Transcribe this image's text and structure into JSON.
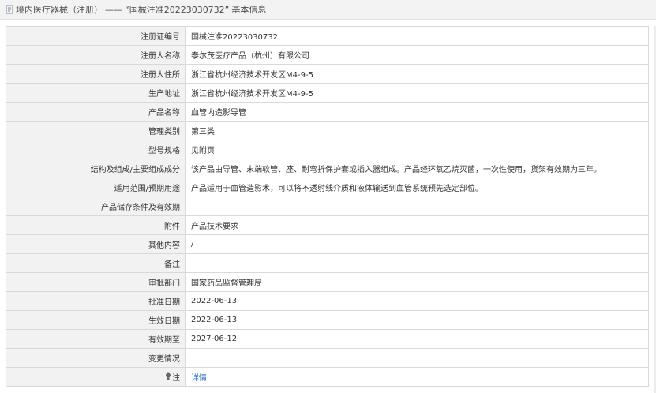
{
  "header": {
    "category": "境内医疗器械（注册）",
    "separator": "——",
    "record_title": "“国械注准20223030732”",
    "suffix": "基本信息"
  },
  "rows": [
    {
      "label": "注册证编号",
      "value": "国械注准20223030732"
    },
    {
      "label": "注册人名称",
      "value": "泰尔茂医疗产品（杭州）有限公司"
    },
    {
      "label": "注册人住所",
      "value": "浙江省杭州经济技术开发区M4-9-5"
    },
    {
      "label": "生产地址",
      "value": "浙江省杭州经济技术开发区M4-9-5"
    },
    {
      "label": "产品名称",
      "value": "血管内造影导管"
    },
    {
      "label": "管理类别",
      "value": "第三类"
    },
    {
      "label": "型号规格",
      "value": "见附页"
    },
    {
      "label": "结构及组成/主要组成成分",
      "value": "该产品由导管、末端软管、座、耐弯折保护套或插入器组成。产品经环氧乙烷灭菌，一次性使用，货架有效期为三年。"
    },
    {
      "label": "适用范围/预期用途",
      "value": "产品适用于血管造影术，可以将不透射线介质和液体输送到血管系统预先选定部位。"
    },
    {
      "label": "产品储存条件及有效期",
      "value": ""
    },
    {
      "label": "附件",
      "value": "产品技术要求"
    },
    {
      "label": "其他内容",
      "value": "/"
    },
    {
      "label": "备注",
      "value": ""
    },
    {
      "label": "审批部门",
      "value": "国家药品监督管理局"
    },
    {
      "label": "批准日期",
      "value": "2022-06-13"
    },
    {
      "label": "生效日期",
      "value": "2022-06-13"
    },
    {
      "label": "有效期至",
      "value": "2027-06-12"
    },
    {
      "label": "变更情况",
      "value": ""
    }
  ],
  "note_row": {
    "label": "注",
    "link": "详情"
  },
  "icons": {
    "header": "document-icon",
    "note": "lightbulb-icon"
  },
  "colors": {
    "link": "#2b6cc4",
    "label_bg": "#f2f2f2",
    "border": "#d9d9d9"
  }
}
